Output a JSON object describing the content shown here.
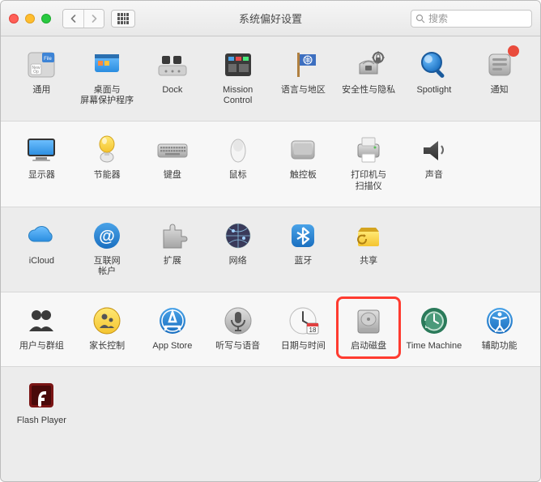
{
  "window": {
    "title": "系统偏好设置",
    "search_placeholder": "搜索"
  },
  "sections": [
    {
      "bg": "norm",
      "items": [
        {
          "id": "general",
          "label": "通用"
        },
        {
          "id": "desktop",
          "label": "桌面与\n屏幕保护程序"
        },
        {
          "id": "dock",
          "label": "Dock"
        },
        {
          "id": "mission-control",
          "label": "Mission\nControl"
        },
        {
          "id": "language",
          "label": "语言与地区"
        },
        {
          "id": "security",
          "label": "安全性与隐私"
        },
        {
          "id": "spotlight",
          "label": "Spotlight"
        },
        {
          "id": "notifications",
          "label": "通知",
          "badge": true
        }
      ]
    },
    {
      "bg": "alt",
      "items": [
        {
          "id": "displays",
          "label": "显示器"
        },
        {
          "id": "energy",
          "label": "节能器"
        },
        {
          "id": "keyboard",
          "label": "键盘"
        },
        {
          "id": "mouse",
          "label": "鼠标"
        },
        {
          "id": "trackpad",
          "label": "触控板"
        },
        {
          "id": "printers",
          "label": "打印机与\n扫描仪"
        },
        {
          "id": "sound",
          "label": "声音"
        }
      ]
    },
    {
      "bg": "norm",
      "items": [
        {
          "id": "icloud",
          "label": "iCloud"
        },
        {
          "id": "internet-accounts",
          "label": "互联网\n帐户"
        },
        {
          "id": "extensions",
          "label": "扩展"
        },
        {
          "id": "network",
          "label": "网络"
        },
        {
          "id": "bluetooth",
          "label": "蓝牙"
        },
        {
          "id": "sharing",
          "label": "共享"
        }
      ]
    },
    {
      "bg": "alt",
      "items": [
        {
          "id": "users",
          "label": "用户与群组"
        },
        {
          "id": "parental",
          "label": "家长控制"
        },
        {
          "id": "app-store",
          "label": "App Store"
        },
        {
          "id": "dictation",
          "label": "听写与语音"
        },
        {
          "id": "date-time",
          "label": "日期与时间"
        },
        {
          "id": "startup-disk",
          "label": "启动磁盘",
          "highlighted": true
        },
        {
          "id": "time-machine",
          "label": "Time Machine"
        },
        {
          "id": "accessibility",
          "label": "辅助功能"
        }
      ]
    },
    {
      "bg": "norm",
      "items": [
        {
          "id": "flash-player",
          "label": "Flash Player"
        }
      ]
    }
  ]
}
